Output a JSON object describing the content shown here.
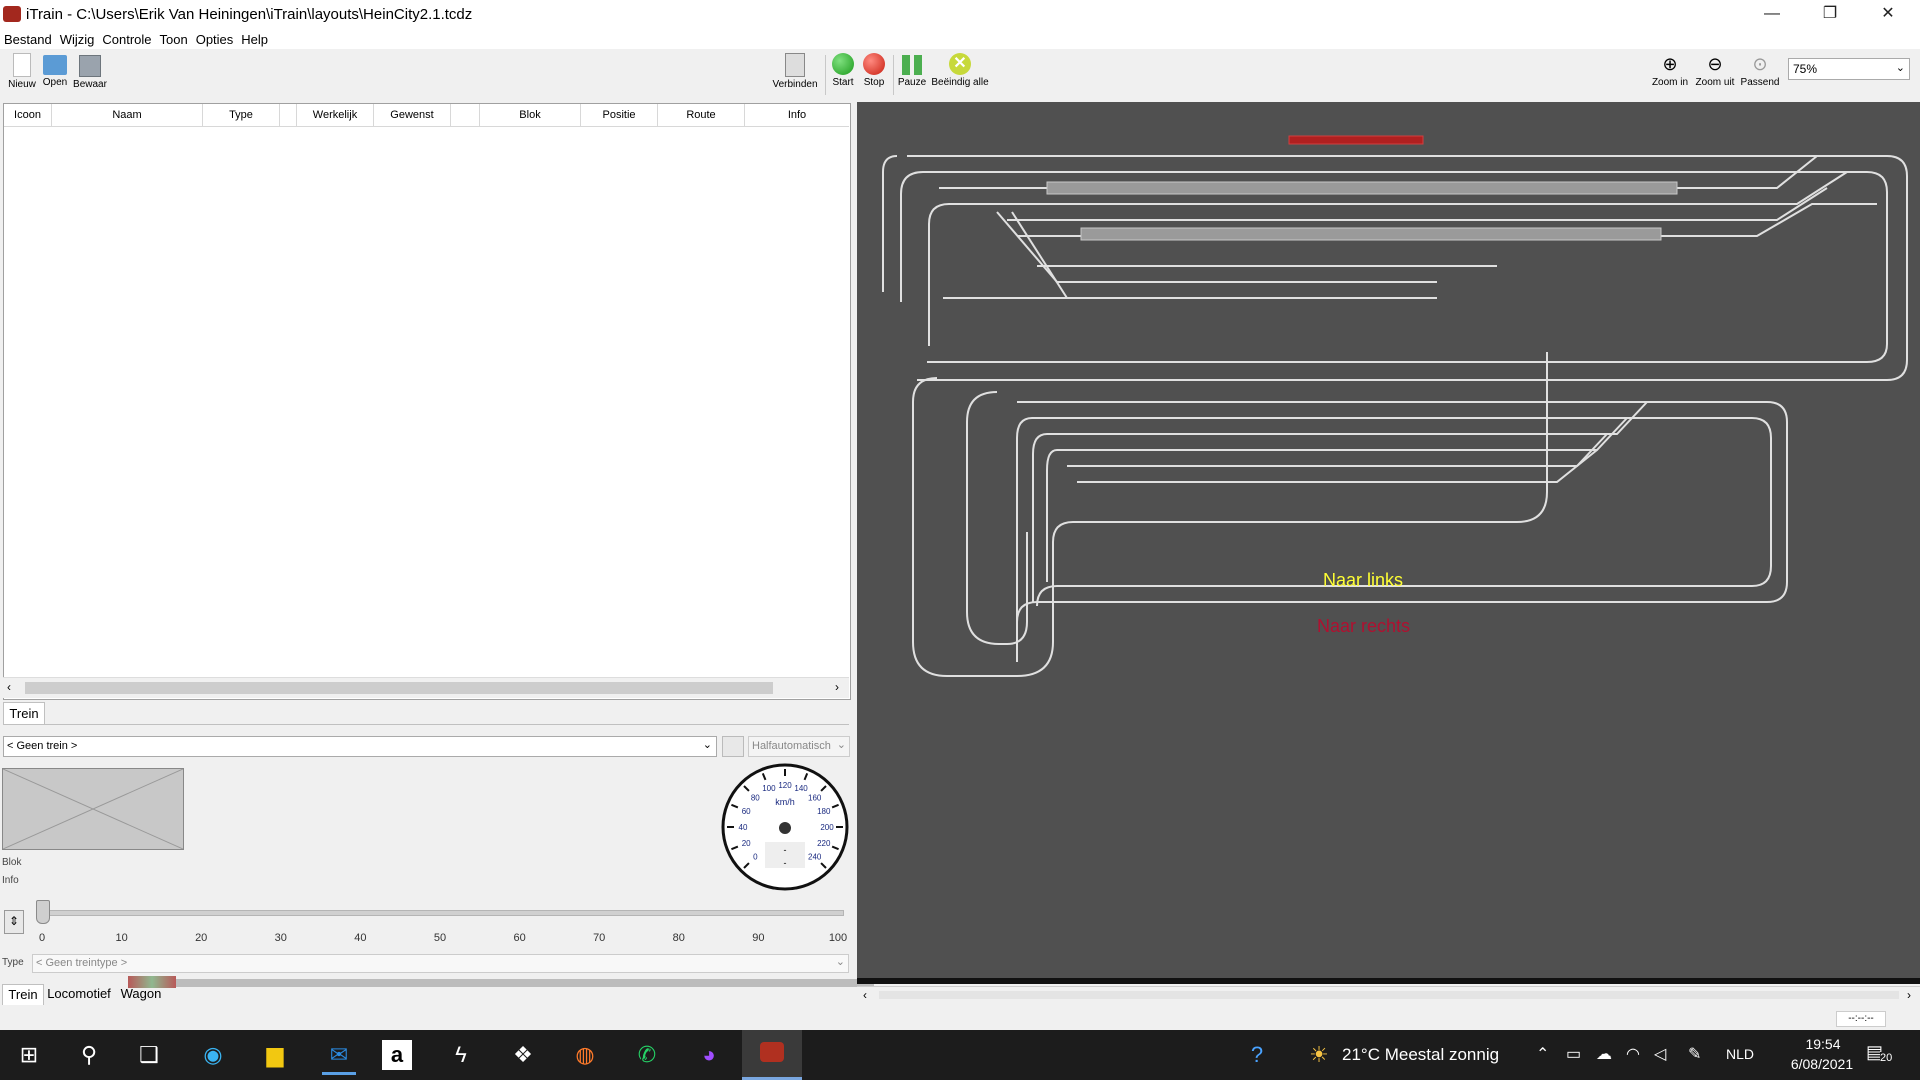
{
  "window": {
    "title": "iTrain - C:\\Users\\Erik Van Heiningen\\iTrain\\layouts\\HeinCity2.1.tcdz",
    "minimize_glyph": "—",
    "maximize_glyph": "❐",
    "close_glyph": "✕"
  },
  "menu": [
    "Bestand",
    "Wijzig",
    "Controle",
    "Toon",
    "Opties",
    "Help"
  ],
  "toolbar": {
    "new": "Nieuw",
    "open": "Open",
    "save": "Bewaar",
    "connect": "Verbinden",
    "start": "Start",
    "stop": "Stop",
    "pause": "Pauze",
    "end_all": "Beëindig alle",
    "zoom_in": "Zoom in",
    "zoom_out": "Zoom uit",
    "fit": "Passend",
    "zoom_level": "75%"
  },
  "table": {
    "columns": [
      "Icoon",
      "Naam",
      "Type",
      "Werkelijk",
      "Gewenst",
      "Blok",
      "Positie",
      "Route",
      "Info"
    ]
  },
  "upper_tabs": {
    "train": "Trein"
  },
  "control": {
    "train_select": "< Geen trein >",
    "mode": "Halfautomatisch",
    "block_label": "Blok",
    "info_label": "Info",
    "speed_unit": "km/h",
    "speed_ticks": [
      "0",
      "20",
      "40",
      "60",
      "80",
      "100",
      "120",
      "140",
      "160",
      "180",
      "200",
      "220",
      "240"
    ],
    "speed_readout_1": "-",
    "speed_readout_2": "-",
    "slider_ticks": [
      "0",
      "10",
      "20",
      "30",
      "40",
      "50",
      "60",
      "70",
      "80",
      "90",
      "100"
    ],
    "slider_value": 0,
    "type_label": "Type",
    "type_select": "< Geen treintype >"
  },
  "lower_tabs": [
    "Trein",
    "Locomotief",
    "Wagon"
  ],
  "layout": {
    "label_left": "Naar links",
    "label_right": "Naar rechts",
    "label_left_color": "#ffff33",
    "label_right_color": "#b01030",
    "background": "#505050",
    "track_color": "#e0e0e0"
  },
  "status": {
    "clock": "--:--:--"
  },
  "taskbar": {
    "weather": "21°C  Meestal zonnig",
    "lang": "NLD",
    "time": "19:54",
    "date": "6/08/2021",
    "notifications": "20"
  }
}
